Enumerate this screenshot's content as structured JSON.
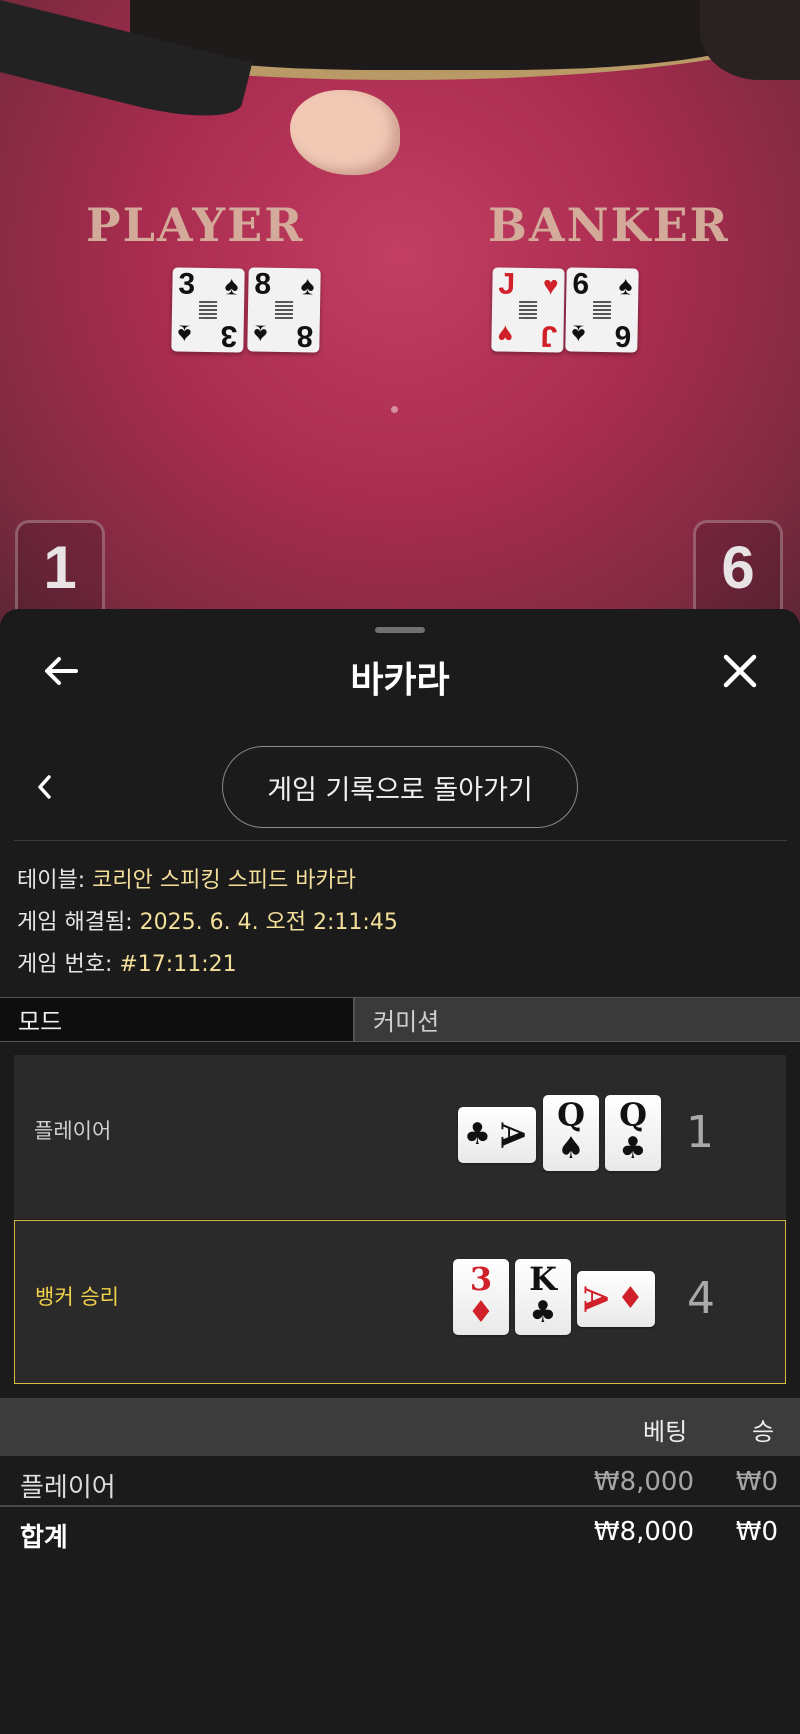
{
  "video": {
    "player_label": "PLAYER",
    "banker_label": "BANKER",
    "player_cards": [
      {
        "rank": "3",
        "suit": "♠",
        "color": "black"
      },
      {
        "rank": "8",
        "suit": "♠",
        "color": "black"
      }
    ],
    "banker_cards": [
      {
        "rank": "J",
        "suit": "♥",
        "color": "red"
      },
      {
        "rank": "6",
        "suit": "♠",
        "color": "black"
      }
    ],
    "player_score": "1",
    "banker_score": "6"
  },
  "sheet": {
    "title": "바카라",
    "back_icon": "arrow-left-icon",
    "close_icon": "close-icon",
    "return_button": "게임 기록으로 돌아가기",
    "info": {
      "table_label": "테이블: ",
      "table_value": "코리안 스피킹 스피드 바카라",
      "resolved_label": "게임 해결됨: ",
      "resolved_value": "2025. 6. 4. 오전 2:11:45",
      "number_label": "게임 번호: ",
      "number_value": "#17:11:21"
    },
    "mode": {
      "left": "모드",
      "right": "커미션"
    },
    "hands": {
      "player": {
        "label": "플레이어",
        "total": "1",
        "cards": [
          {
            "rank": "A",
            "suit": "♣",
            "color": "black",
            "sideways": true
          },
          {
            "rank": "Q",
            "suit": "♠",
            "color": "black",
            "sideways": false
          },
          {
            "rank": "Q",
            "suit": "♣",
            "color": "black",
            "sideways": false
          }
        ]
      },
      "banker": {
        "label": "뱅커 승리",
        "total": "4",
        "cards": [
          {
            "rank": "3",
            "suit": "♦",
            "color": "red",
            "sideways": false
          },
          {
            "rank": "K",
            "suit": "♣",
            "color": "black",
            "sideways": false
          },
          {
            "rank": "A",
            "suit": "♦",
            "color": "red",
            "sideways": true
          }
        ]
      }
    },
    "bets": {
      "headers": {
        "bet": "베팅",
        "win": "승"
      },
      "rows": [
        {
          "name": "플레이어",
          "bet": "₩8,000",
          "win": "₩0"
        }
      ],
      "total": {
        "name": "합계",
        "bet": "₩8,000",
        "win": "₩0"
      }
    },
    "accent_color": "#d7ba3f"
  }
}
